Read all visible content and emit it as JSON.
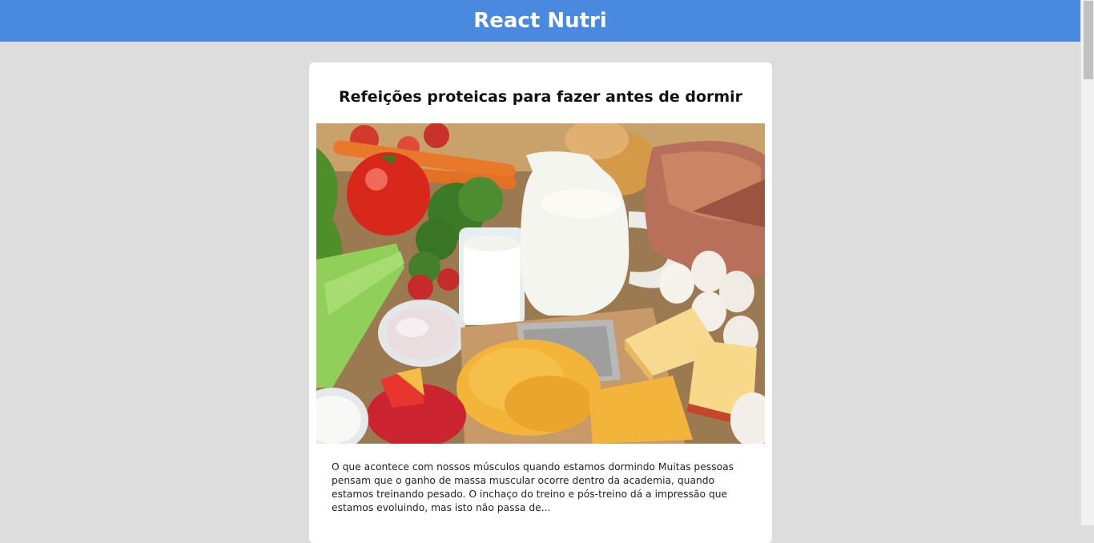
{
  "header": {
    "title": "React Nutri",
    "color": "#4a89e0"
  },
  "post": {
    "title": "Refeições proteicas para fazer antes de dormir",
    "image_alt": "food-image",
    "excerpt": "O que acontece com nossos músculos quando estamos dormindo Muitas pessoas pensam que o ganho de massa muscular ocorre dentro da academia, quando estamos treinando pesado. O inchaço do treino e pós-treino dá a impressão que estamos evoluindo, mas isto não passa de..."
  },
  "colors": {
    "background": "#dddddd",
    "card": "#ffffff"
  }
}
